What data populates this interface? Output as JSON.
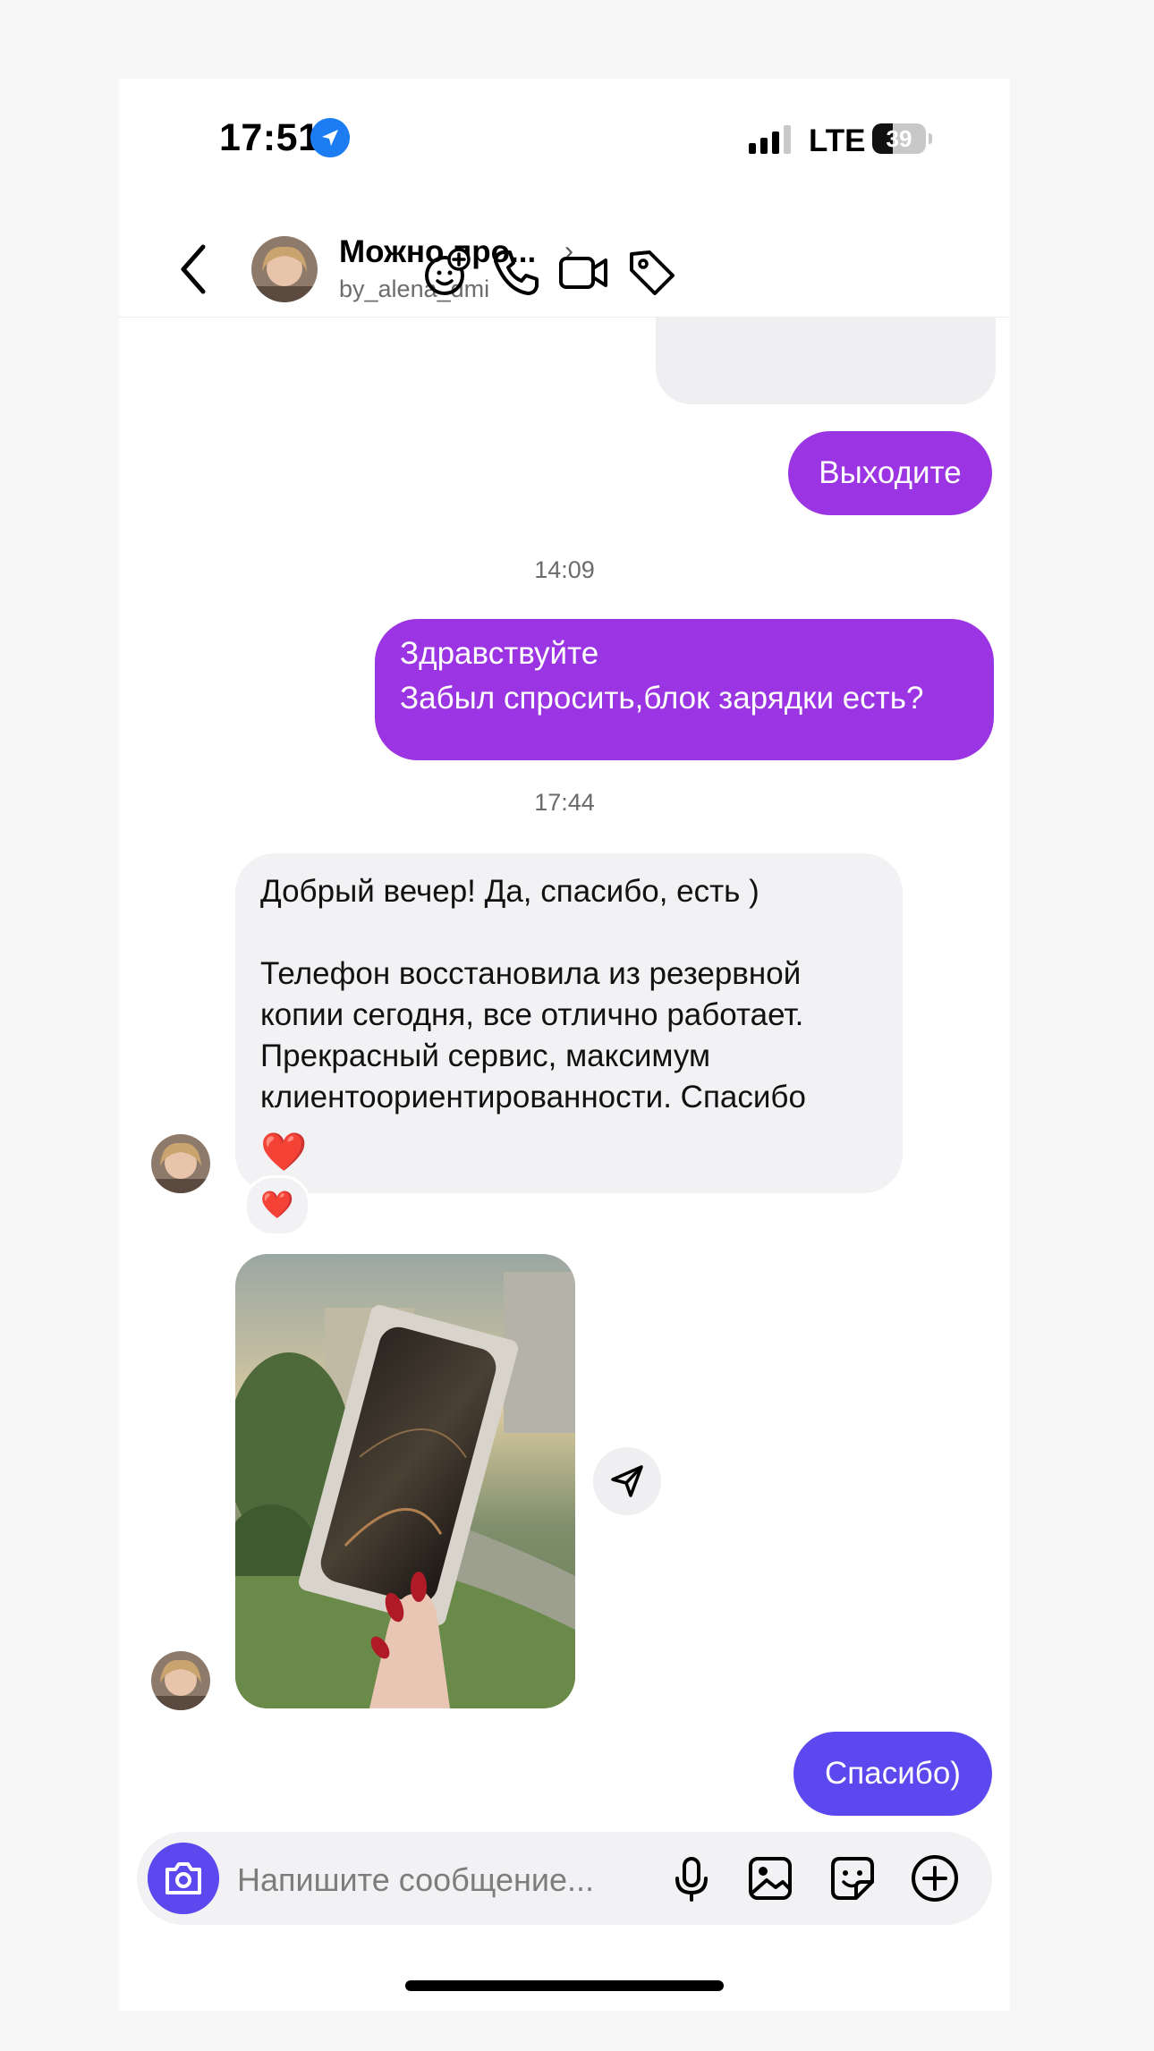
{
  "status_bar": {
    "time": "17:51",
    "network": "LTE",
    "battery": "39",
    "battery_level": 0.39
  },
  "header": {
    "name": "Можно про...",
    "username": "by_alena_dmi"
  },
  "messages": {
    "out_1": "Выходите",
    "timestamp_1": "14:09",
    "out_2": "Здравствуйте\nЗабыл спросить,блок зарядки есть?",
    "timestamp_2": "17:44",
    "in_1": "Добрый вечер! Да, спасибо, есть )\n\nТелефон восстановила из резервной копии сегодня, все отлично работает. Прекрасный сервис, максимум клиентоориентированности. Спасибо",
    "in_1_emoji": "❤️",
    "reaction": "❤️",
    "out_3": "Спасибо)"
  },
  "composer": {
    "placeholder": "Напишите сообщение..."
  },
  "icons": {
    "back": "chevron-left-icon",
    "sticker": "sticker-add-icon",
    "call": "phone-icon",
    "video": "video-icon",
    "tag": "tag-icon",
    "camera": "camera-icon",
    "mic": "microphone-icon",
    "gallery": "image-icon",
    "sticker_compose": "sticker-icon",
    "add": "plus-circle-icon",
    "share": "send-icon"
  },
  "colors": {
    "outgoing_purple": "#9b34e2",
    "outgoing_blue": "#5b48ef",
    "incoming": "#f2f2f4",
    "accent": "#5b48ef"
  }
}
